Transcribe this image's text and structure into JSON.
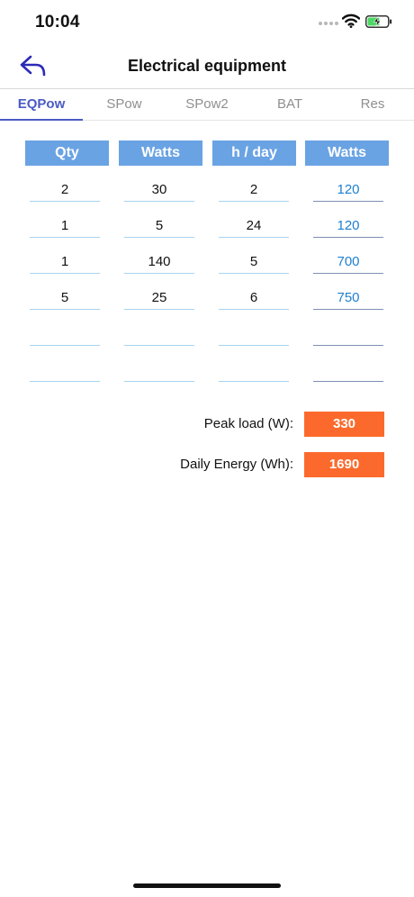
{
  "status_bar": {
    "time": "10:04"
  },
  "nav": {
    "title": "Electrical equipment",
    "back_icon": "back-arrow-icon"
  },
  "tabs": [
    {
      "label": "EQPow",
      "active": true
    },
    {
      "label": "SPow",
      "active": false
    },
    {
      "label": "SPow2",
      "active": false
    },
    {
      "label": "BAT",
      "active": false
    },
    {
      "label": "Res",
      "active": false
    }
  ],
  "table": {
    "headers": [
      "Qty",
      "Watts",
      "h / day",
      "Watts"
    ],
    "rows": [
      [
        "2",
        "30",
        "2",
        "120"
      ],
      [
        "1",
        "5",
        "24",
        "120"
      ],
      [
        "1",
        "140",
        "5",
        "700"
      ],
      [
        "5",
        "25",
        "6",
        "750"
      ],
      [
        "",
        "",
        "",
        ""
      ],
      [
        "",
        "",
        "",
        ""
      ]
    ]
  },
  "summary": {
    "peak_label": "Peak load (W):",
    "peak_value": "330",
    "energy_label": "Daily Energy (Wh):",
    "energy_value": "1690"
  },
  "colors": {
    "accent": "#4a5bc4",
    "header_bg": "#6aa3e3",
    "result_text": "#1e7fd0",
    "summary_bg": "#fb6a2c"
  }
}
